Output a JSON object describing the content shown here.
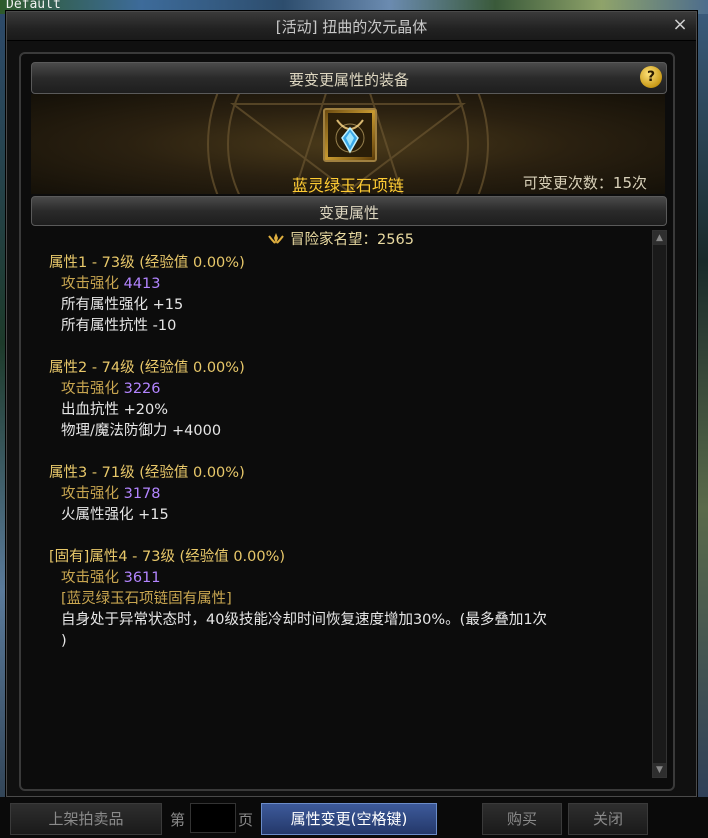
{
  "background_label": "Default",
  "window": {
    "title": "[活动] 扭曲的次元晶体",
    "close_glyph": "×"
  },
  "equipment_section": {
    "header": "要变更属性的装备",
    "help_glyph": "?",
    "item_name": "蓝灵绿玉石项链",
    "change_count": "可变更次数：15次"
  },
  "attributes_section": {
    "header": "变更属性",
    "reputation": "冒险家名望：2565",
    "attributes": [
      {
        "head": "属性1 - 73级 (经验值 0.00%)",
        "lines": [
          {
            "label": "攻击强化 ",
            "value": "4413",
            "type": "attack"
          },
          {
            "label": "所有属性强化 +15",
            "type": "white"
          },
          {
            "label": "所有属性抗性 -10",
            "type": "white"
          }
        ]
      },
      {
        "head": "属性2 - 74级 (经验值 0.00%)",
        "lines": [
          {
            "label": "攻击强化 ",
            "value": "3226",
            "type": "attack"
          },
          {
            "label": "出血抗性 +20%",
            "type": "white"
          },
          {
            "label": "物理/魔法防御力 +4000",
            "type": "white"
          }
        ]
      },
      {
        "head": "属性3 - 71级 (经验值 0.00%)",
        "lines": [
          {
            "label": "攻击强化 ",
            "value": "3178",
            "type": "attack"
          },
          {
            "label": "火属性强化 +15",
            "type": "white"
          }
        ]
      },
      {
        "head": "[固有]属性4 - 73级 (经验值 0.00%)",
        "lines": [
          {
            "label": "攻击强化 ",
            "value": "3611",
            "type": "attack"
          },
          {
            "label": "[蓝灵绿玉石项链固有属性]",
            "type": "gold"
          },
          {
            "label": "自身处于异常状态时，40级技能冷却时间恢复速度增加30%。(最多叠加1次",
            "type": "white"
          },
          {
            "label": ")",
            "type": "white"
          }
        ]
      }
    ]
  },
  "bottom_bar": {
    "list_button": "上架拍卖品",
    "page_prefix": "第",
    "page_suffix": "页",
    "primary_button": "属性变更(空格键)",
    "buy_button": "购买",
    "close_button": "关闭"
  },
  "colors": {
    "attr_head": "#e8c86a",
    "attack_value": "#b385ff",
    "item_name": "#ffcc33",
    "primary_button": "#3d5a9a"
  }
}
